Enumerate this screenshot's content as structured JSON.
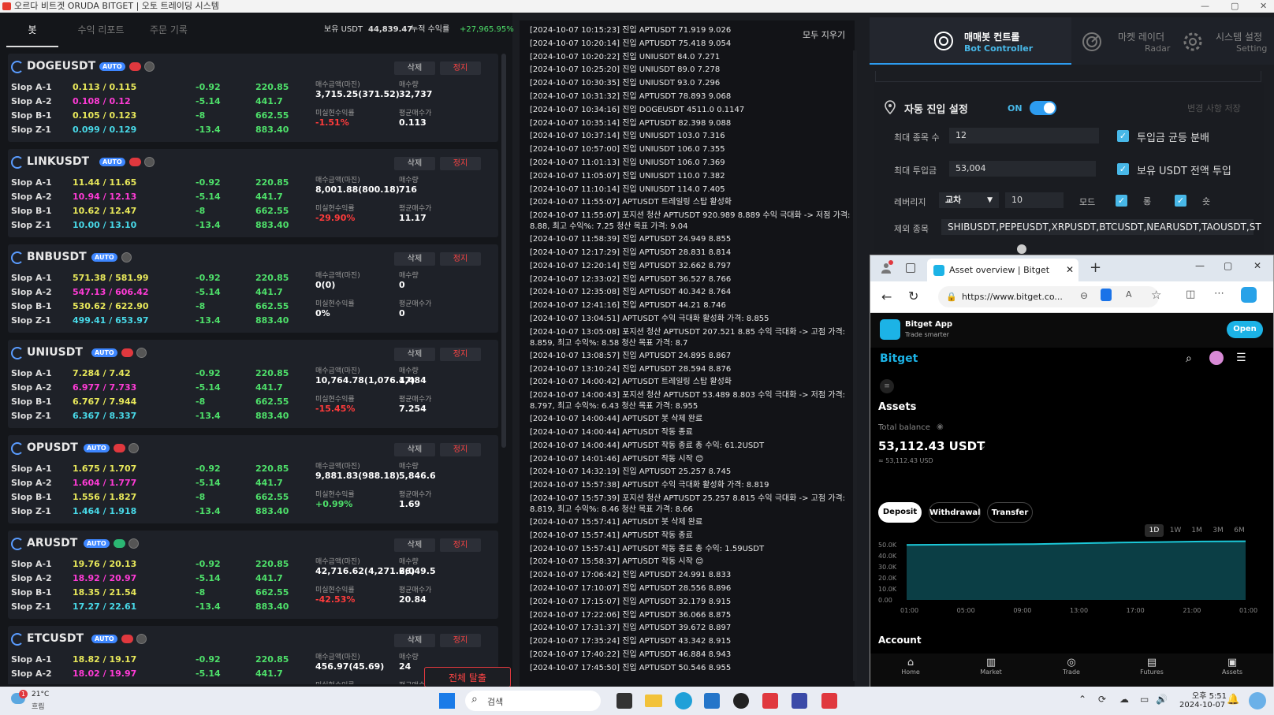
{
  "window": {
    "title": "오르다 비트겟 ORUDA BITGET | 오토 트레이딩 시스템",
    "min": "—",
    "max": "▢",
    "close": "✕"
  },
  "tabs": [
    {
      "label": "봇"
    },
    {
      "label": "수익 리포트"
    },
    {
      "label": "주문 기록"
    }
  ],
  "summary": {
    "usdt_label": "보유 USDT",
    "usdt_value": "44,839.47",
    "profit_label": "누적 수익률",
    "profit_value": "+27,965.95%"
  },
  "card_labels": {
    "delete": "삭제",
    "stop": "정지",
    "auto": "AUTO",
    "buy_amount": "매수금액(마진)",
    "buy_qty": "매수량",
    "unrealized": "미실현수익률",
    "avg_price": "평균매수가"
  },
  "bots": [
    {
      "symbol": "DOGEUSDT",
      "status": "red",
      "rows": [
        {
          "name": "Slop A-1",
          "range": "0.113 / 0.115",
          "pct": "-0.92",
          "amt": "220.85",
          "range_color": "yellow"
        },
        {
          "name": "Slop A-2",
          "range": "0.108 / 0.12",
          "pct": "-5.14",
          "amt": "441.7",
          "range_color": "pink"
        },
        {
          "name": "Slop B-1",
          "range": "0.105 / 0.123",
          "pct": "-8",
          "amt": "662.55",
          "range_color": "yellow"
        },
        {
          "name": "Slop Z-1",
          "range": "0.099 / 0.129",
          "pct": "-13.4",
          "amt": "883.40",
          "range_color": "cyan"
        }
      ],
      "buy_amount": "3,715.25(371.52)",
      "buy_qty": "32,737",
      "unrealized": "-1.51%",
      "unrealized_color": "red",
      "avg_price": "0.113"
    },
    {
      "symbol": "LINKUSDT",
      "status": "red",
      "rows": [
        {
          "name": "Slop A-1",
          "range": "11.44 / 11.65",
          "pct": "-0.92",
          "amt": "220.85",
          "range_color": "yellow"
        },
        {
          "name": "Slop A-2",
          "range": "10.94 / 12.13",
          "pct": "-5.14",
          "amt": "441.7",
          "range_color": "pink"
        },
        {
          "name": "Slop B-1",
          "range": "10.62 / 12.47",
          "pct": "-8",
          "amt": "662.55",
          "range_color": "yellow"
        },
        {
          "name": "Slop Z-1",
          "range": "10.00 / 13.10",
          "pct": "-13.4",
          "amt": "883.40",
          "range_color": "cyan"
        }
      ],
      "buy_amount": "8,001.88(800.18)",
      "buy_qty": "716",
      "unrealized": "-29.90%",
      "unrealized_color": "red",
      "avg_price": "11.17"
    },
    {
      "symbol": "BNBUSDT",
      "status": "none",
      "rows": [
        {
          "name": "Slop A-1",
          "range": "571.38 / 581.99",
          "pct": "-0.92",
          "amt": "220.85",
          "range_color": "yellow"
        },
        {
          "name": "Slop A-2",
          "range": "547.13 / 606.42",
          "pct": "-5.14",
          "amt": "441.7",
          "range_color": "pink"
        },
        {
          "name": "Slop B-1",
          "range": "530.62 / 622.90",
          "pct": "-8",
          "amt": "662.55",
          "range_color": "yellow"
        },
        {
          "name": "Slop Z-1",
          "range": "499.41 / 653.97",
          "pct": "-13.4",
          "amt": "883.40",
          "range_color": "cyan"
        }
      ],
      "buy_amount": "0(0)",
      "buy_qty": "0",
      "unrealized": "0%",
      "unrealized_color": "white",
      "avg_price": "0"
    },
    {
      "symbol": "UNIUSDT",
      "status": "red",
      "rows": [
        {
          "name": "Slop A-1",
          "range": "7.284 / 7.42",
          "pct": "-0.92",
          "amt": "220.85",
          "range_color": "yellow"
        },
        {
          "name": "Slop A-2",
          "range": "6.977 / 7.733",
          "pct": "-5.14",
          "amt": "441.7",
          "range_color": "pink"
        },
        {
          "name": "Slop B-1",
          "range": "6.767 / 7.944",
          "pct": "-8",
          "amt": "662.55",
          "range_color": "yellow"
        },
        {
          "name": "Slop Z-1",
          "range": "6.367 / 8.337",
          "pct": "-13.4",
          "amt": "883.40",
          "range_color": "cyan"
        }
      ],
      "buy_amount": "10,764.78(1,076.47)",
      "buy_qty": "1,484",
      "unrealized": "-15.45%",
      "unrealized_color": "red",
      "avg_price": "7.254"
    },
    {
      "symbol": "OPUSDT",
      "status": "red",
      "rows": [
        {
          "name": "Slop A-1",
          "range": "1.675 / 1.707",
          "pct": "-0.92",
          "amt": "220.85",
          "range_color": "yellow"
        },
        {
          "name": "Slop A-2",
          "range": "1.604 / 1.777",
          "pct": "-5.14",
          "amt": "441.7",
          "range_color": "pink"
        },
        {
          "name": "Slop B-1",
          "range": "1.556 / 1.827",
          "pct": "-8",
          "amt": "662.55",
          "range_color": "yellow"
        },
        {
          "name": "Slop Z-1",
          "range": "1.464 / 1.918",
          "pct": "-13.4",
          "amt": "883.40",
          "range_color": "cyan"
        }
      ],
      "buy_amount": "9,881.83(988.18)",
      "buy_qty": "5,846.6",
      "unrealized": "+0.99%",
      "unrealized_color": "green",
      "avg_price": "1.69"
    },
    {
      "symbol": "ARUSDT",
      "status": "green",
      "rows": [
        {
          "name": "Slop A-1",
          "range": "19.76 / 20.13",
          "pct": "-0.92",
          "amt": "220.85",
          "range_color": "yellow"
        },
        {
          "name": "Slop A-2",
          "range": "18.92 / 20.97",
          "pct": "-5.14",
          "amt": "441.7",
          "range_color": "pink"
        },
        {
          "name": "Slop B-1",
          "range": "18.35 / 21.54",
          "pct": "-8",
          "amt": "662.55",
          "range_color": "yellow"
        },
        {
          "name": "Slop Z-1",
          "range": "17.27 / 22.61",
          "pct": "-13.4",
          "amt": "883.40",
          "range_color": "cyan"
        }
      ],
      "buy_amount": "42,716.62(4,271.66)",
      "buy_qty": "2,049.5",
      "unrealized": "-42.53%",
      "unrealized_color": "red",
      "avg_price": "20.84"
    },
    {
      "symbol": "ETCUSDT",
      "status": "red",
      "rows": [
        {
          "name": "Slop A-1",
          "range": "18.82 / 19.17",
          "pct": "-0.92",
          "amt": "220.85",
          "range_color": "yellow"
        },
        {
          "name": "Slop A-2",
          "range": "18.02 / 19.97",
          "pct": "-5.14",
          "amt": "441.7",
          "range_color": "pink"
        }
      ],
      "buy_amount": "456.97(45.69)",
      "buy_qty": "24",
      "unrealized": "",
      "unrealized_color": "red",
      "avg_price": ""
    }
  ],
  "exit_all": "전체 탈출",
  "log": {
    "clear_label": "모두 지우기",
    "lines": [
      "[2024-10-07 10:15:23] 진입 APTUSDT 71.919 9.026",
      "[2024-10-07 10:20:14] 진입 APTUSDT 75.418 9.054",
      "[2024-10-07 10:20:22] 진입 UNIUSDT 84.0 7.271",
      "[2024-10-07 10:25:20] 진입 UNIUSDT 89.0 7.278",
      "[2024-10-07 10:30:35] 진입 UNIUSDT 93.0 7.296",
      "[2024-10-07 10:31:32] 진입 APTUSDT 78.893 9.068",
      "[2024-10-07 10:34:16] 진입 DOGEUSDT 4511.0 0.1147",
      "[2024-10-07 10:35:14] 진입 APTUSDT 82.398 9.088",
      "[2024-10-07 10:37:14] 진입 UNIUSDT 103.0 7.316",
      "[2024-10-07 10:57:00] 진입 UNIUSDT 106.0 7.355",
      "[2024-10-07 11:01:13] 진입 UNIUSDT 106.0 7.369",
      "[2024-10-07 11:05:07] 진입 UNIUSDT 110.0 7.382",
      "[2024-10-07 11:10:14] 진입 UNIUSDT 114.0 7.405",
      "[2024-10-07 11:55:07] APTUSDT 트레일링 스탑 활성화",
      "[2024-10-07 11:55:07] 포지션 청산 APTUSDT 920.989 8.889 수익 극대화 -> 저점 가격: 8.88, 최고 수익%: 7.25 청산 목표 가격: 9.04",
      "[2024-10-07 11:58:39] 진입 APTUSDT 24.949 8.855",
      "[2024-10-07 12:17:29] 진입 APTUSDT 28.831 8.814",
      "[2024-10-07 12:20:14] 진입 APTUSDT 32.662 8.797",
      "[2024-10-07 12:33:02] 진입 APTUSDT 36.527 8.766",
      "[2024-10-07 12:35:08] 진입 APTUSDT 40.342 8.764",
      "[2024-10-07 12:41:16] 진입 APTUSDT 44.21 8.746",
      "[2024-10-07 13:04:51] APTUSDT 수익 극대화 활성화 가격: 8.855",
      "[2024-10-07 13:05:08] 포지션 청산 APTUSDT 207.521 8.85 수익 극대화 -> 고점 가격: 8.859, 최고 수익%: 8.58 청산 목표 가격: 8.7",
      "[2024-10-07 13:08:57] 진입 APTUSDT 24.895 8.867",
      "[2024-10-07 13:10:24] 진입 APTUSDT 28.594 8.876",
      "[2024-10-07 14:00:42] APTUSDT 트레일링 스탑 활성화",
      "[2024-10-07 14:00:43] 포지션 청산 APTUSDT 53.489 8.803 수익 극대화 -> 저점 가격: 8.797, 최고 수익%: 6.43 청산 목표 가격: 8.955",
      "[2024-10-07 14:00:44] APTUSDT 봇 삭제 완료",
      "[2024-10-07 14:00:44] APTUSDT 작동 종료",
      "[2024-10-07 14:00:44] APTUSDT 작동 종료 총 수익: 61.2USDT",
      "[2024-10-07 14:01:46] APTUSDT 작동 시작 😊",
      "[2024-10-07 14:32:19] 진입 APTUSDT 25.257 8.745",
      "[2024-10-07 15:57:38] APTUSDT 수익 극대화 활성화 가격: 8.819",
      "[2024-10-07 15:57:39] 포지션 청산 APTUSDT 25.257 8.815 수익 극대화 -> 고점 가격: 8.819, 최고 수익%: 8.46 청산 목표 가격: 8.66",
      "[2024-10-07 15:57:41] APTUSDT 봇 삭제 완료",
      "[2024-10-07 15:57:41] APTUSDT 작동 종료",
      "[2024-10-07 15:57:41] APTUSDT 작동 종료 총 수익: 1.59USDT",
      "[2024-10-07 15:58:37] APTUSDT 작동 시작 😊",
      "[2024-10-07 17:06:42] 진입 APTUSDT 24.991 8.833",
      "[2024-10-07 17:10:07] 진입 APTUSDT 28.556 8.896",
      "[2024-10-07 17:15:07] 진입 APTUSDT 32.179 8.915",
      "[2024-10-07 17:22:06] 진입 APTUSDT 36.066 8.875",
      "[2024-10-07 17:31:37] 진입 APTUSDT 39.672 8.897",
      "[2024-10-07 17:35:24] 진입 APTUSDT 43.342 8.915",
      "[2024-10-07 17:40:22] 진입 APTUSDT 46.884 8.943",
      "[2024-10-07 17:45:50] 진입 APTUSDT 50.546 8.955"
    ]
  },
  "nav": [
    {
      "title": "매매봇 컨트롤",
      "sub": "Bot Controller"
    },
    {
      "title": "마켓 레이더",
      "sub": "Radar"
    },
    {
      "title": "시스템 설정",
      "sub": "Setting"
    }
  ],
  "settings": {
    "title": "자동 진입 설정",
    "on_label": "ON",
    "save_label": "변경 사항 저장",
    "max_symbols_label": "최대 종목 수",
    "max_symbols_value": "12",
    "equal_split_label": "투입금 균등 분배",
    "max_invest_label": "최대 투입금",
    "max_invest_value": "53,004",
    "all_usdt_label": "보유 USDT 전액 투입",
    "leverage_label": "레버리지",
    "leverage_mode": "교차",
    "leverage_value": "10",
    "mode_label": "모드",
    "long_label": "롱",
    "short_label": "숏",
    "exclude_label": "제외 종목",
    "exclude_value": "SHIBUSDT,PEPEUSDT,XRPUSDT,BTCUSDT,NEARUSDT,TAOUSDT,ST"
  },
  "browser": {
    "tab_title": "Asset overview | Bitget",
    "url": "https://www.bitget.co...",
    "app_name": "Bitget App",
    "app_sub": "Trade smarter",
    "open_label": "Open",
    "logo": "Bitget",
    "assets_title": "Assets",
    "total_label": "Total balance",
    "total_value": "53,112.43 USDT",
    "total_usd": "≈ 53,112.43 USD",
    "buttons": [
      "Deposit",
      "Withdrawal",
      "Transfer"
    ],
    "ranges": [
      "1D",
      "1W",
      "1M",
      "3M",
      "6M"
    ],
    "account_title": "Account",
    "bottom_nav": [
      "Home",
      "Market",
      "Trade",
      "Futures",
      "Assets"
    ]
  },
  "chart_data": {
    "type": "area",
    "x": [
      "01:00",
      "05:00",
      "09:00",
      "13:00",
      "17:00",
      "21:00",
      "01:00"
    ],
    "y_ticks": [
      "50.0K",
      "40.0K",
      "30.0K",
      "20.0K",
      "10.0K",
      "0.00"
    ],
    "ylim": [
      0,
      50000
    ],
    "values": [
      49800,
      50100,
      50300,
      50600,
      51200,
      51900,
      52400,
      52900,
      53112
    ]
  },
  "taskbar": {
    "weather_temp": "21°C",
    "weather_desc": "흐림",
    "search_placeholder": "검색",
    "time": "오후 5:51",
    "date": "2024-10-07"
  },
  "colors": {
    "green": "#4ee06a",
    "red": "#ff3b3b",
    "pink": "#ff3bd6",
    "yellow": "#e8e85a",
    "cyan": "#48d9e8",
    "accent": "#2d9cf0"
  }
}
